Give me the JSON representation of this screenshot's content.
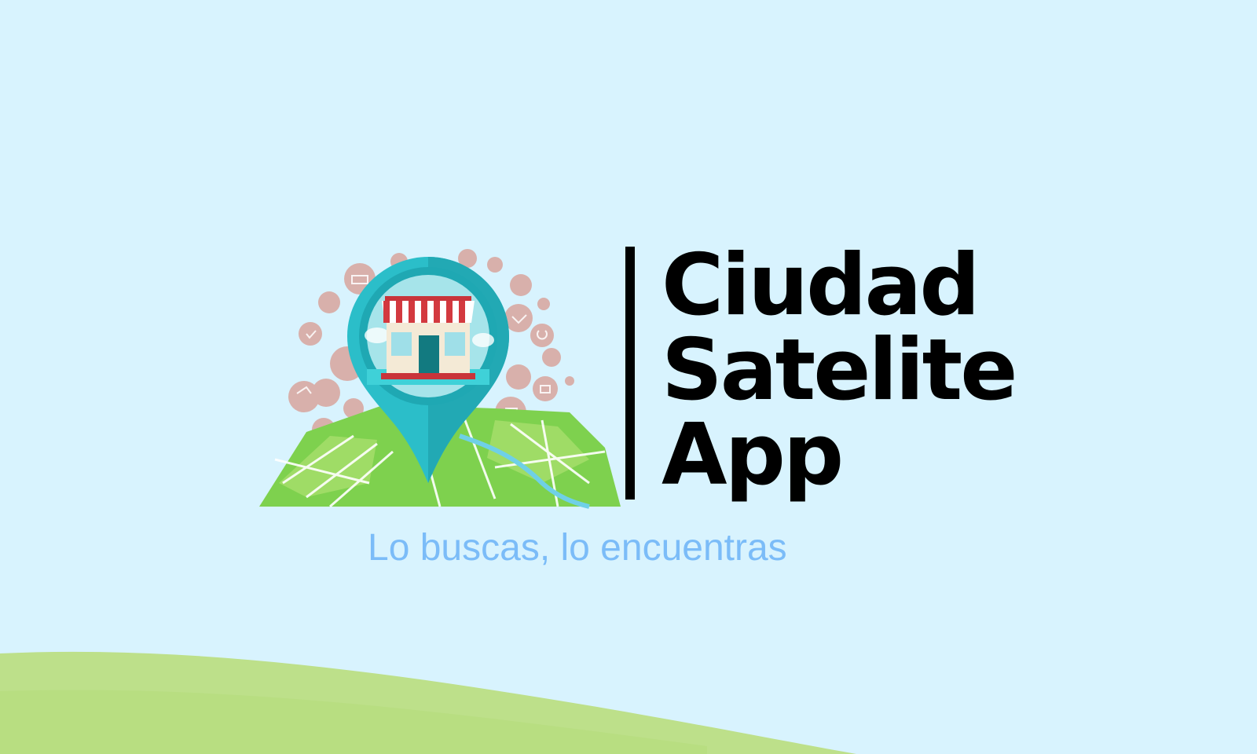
{
  "brand": {
    "line1": "Ciudad",
    "line2": "Satelite",
    "line3": "App"
  },
  "tagline": "Lo buscas, lo encuentras",
  "colors": {
    "background": "#d8f3fe",
    "tagline": "#7bbcf8",
    "pin": "#2bbec9",
    "map_green": "#7ed14e",
    "hill": "#bde08a"
  },
  "icons": [
    "store-icon",
    "location-pin-icon",
    "city-map-icon"
  ]
}
